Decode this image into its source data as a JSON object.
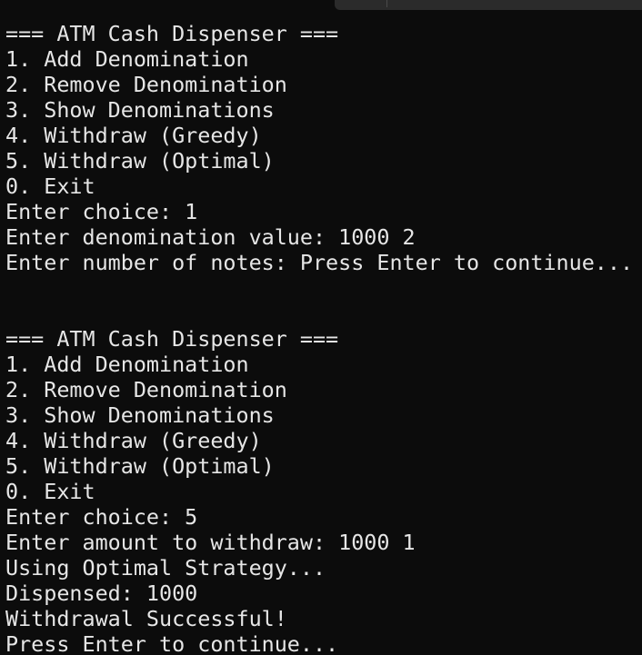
{
  "terminal": {
    "lines": [
      "=== ATM Cash Dispenser ===",
      "1. Add Denomination",
      "2. Remove Denomination",
      "3. Show Denominations",
      "4. Withdraw (Greedy)",
      "5. Withdraw (Optimal)",
      "0. Exit",
      "Enter choice: 1",
      "Enter denomination value: 1000 2",
      "Enter number of notes: Press Enter to continue...",
      "",
      "",
      "=== ATM Cash Dispenser ===",
      "1. Add Denomination",
      "2. Remove Denomination",
      "3. Show Denominations",
      "4. Withdraw (Greedy)",
      "5. Withdraw (Optimal)",
      "0. Exit",
      "Enter choice: 5",
      "Enter amount to withdraw: 1000 1",
      "Using Optimal Strategy...",
      "Dispensed: 1000",
      "Withdrawal Successful!",
      "Press Enter to continue..."
    ]
  },
  "colors": {
    "background": "#0c0c0c",
    "foreground": "#e6e6e6",
    "tab": "#2b2b2b"
  }
}
